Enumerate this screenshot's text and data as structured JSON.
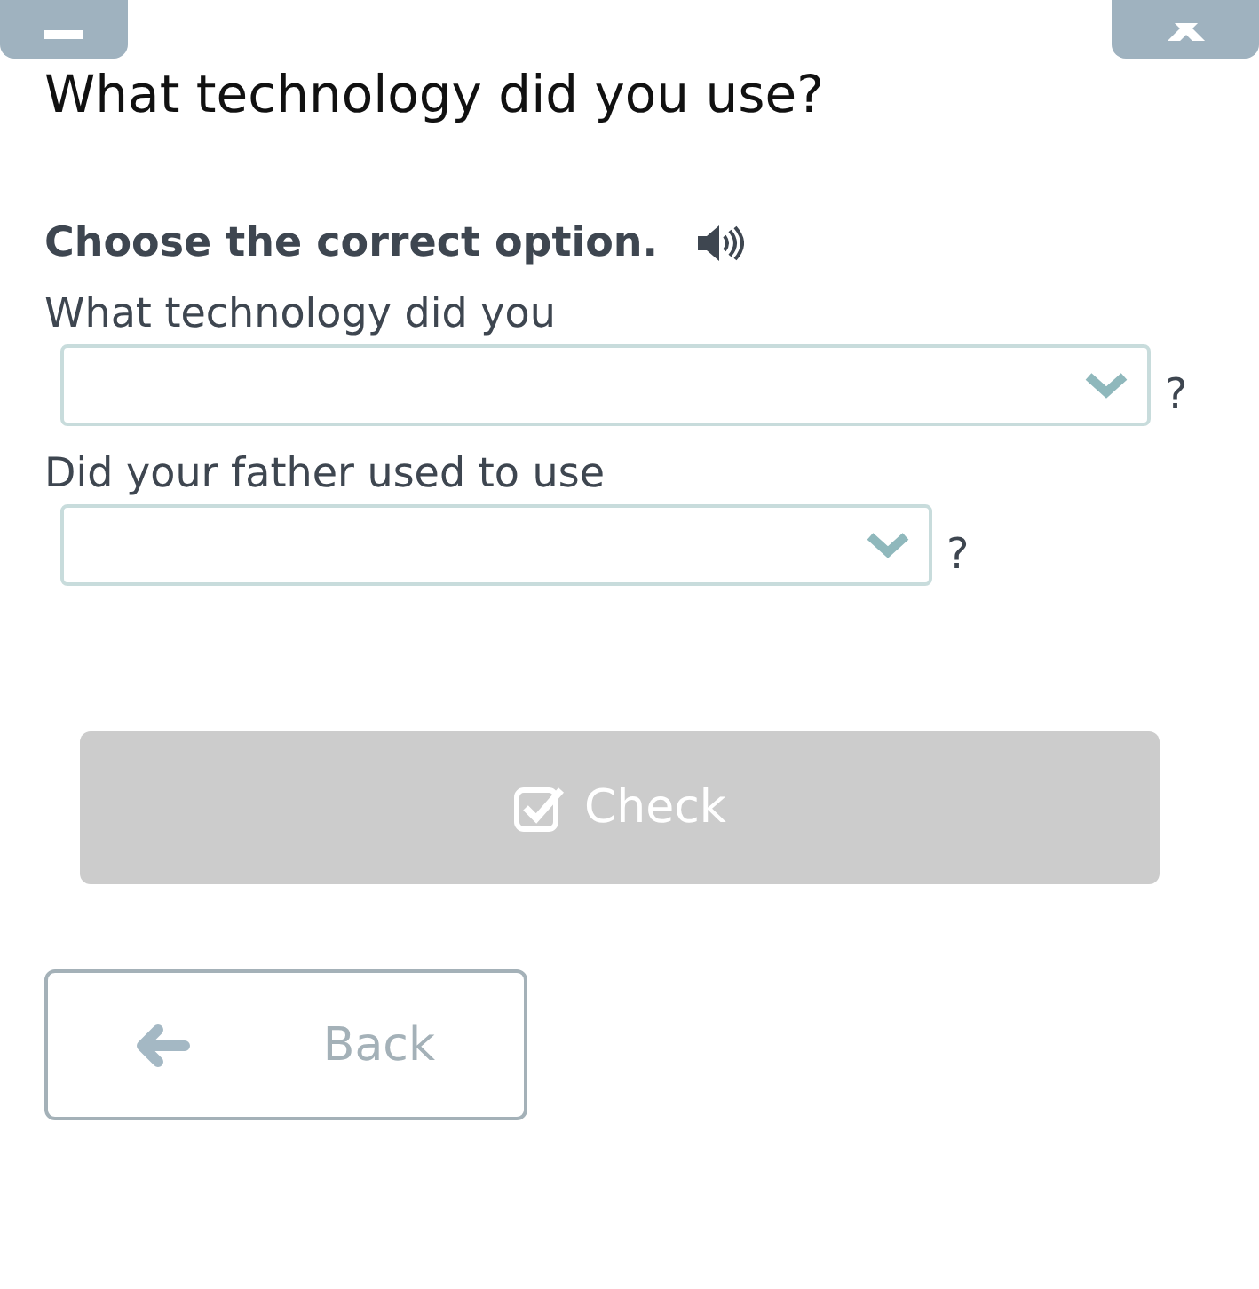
{
  "title": "What technology did you use?",
  "instruction": "Choose the correct option.",
  "questions": [
    {
      "prompt": "What technology did you",
      "suffix": "?",
      "wide": true
    },
    {
      "prompt": "Did your father used to use",
      "suffix": "?",
      "wide": false
    }
  ],
  "check_button": {
    "label": "Check",
    "disabled": true
  },
  "back_button": {
    "label": "Back"
  }
}
